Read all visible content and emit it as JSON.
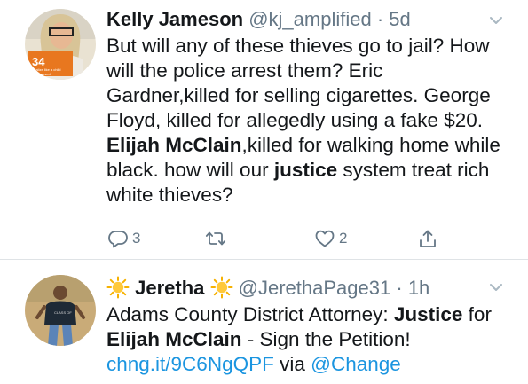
{
  "tweets": [
    {
      "name": "Kelly Jameson",
      "handle": "@kj_amplified",
      "separator": "·",
      "time": "5d",
      "body": [
        {
          "t": "But will any of these thieves go to jail? How will the police arrest them? Eric Gardner,killed for selling cigarettes. George Floyd, killed for allegedly using a fake $20. ",
          "b": false
        },
        {
          "t": "Elijah McClain",
          "b": true
        },
        {
          "t": ",killed for walking home while black. how will our ",
          "b": false
        },
        {
          "t": "justice",
          "b": true
        },
        {
          "t": " system treat rich white thieves?",
          "b": false
        }
      ],
      "avatar_text": {
        "number": "34",
        "line1": "ogalize like a child",
        "line2": "is proposed"
      },
      "actions": {
        "reply_count": "3",
        "retweet_count": "",
        "like_count": "2"
      }
    },
    {
      "name": "Jeretha",
      "handle": "@JerethaPage31",
      "separator": "·",
      "time": "1h",
      "body": [
        {
          "t": "Adams County District Attorney: ",
          "b": false
        },
        {
          "t": "Justice",
          "b": true
        },
        {
          "t": " for ",
          "b": false
        },
        {
          "t": "Elijah McClain",
          "b": true
        },
        {
          "t": " - Sign the Petition! ",
          "b": false
        },
        {
          "t": "chng.it/9C6NgQPF",
          "b": false,
          "link": true
        },
        {
          "t": " via ",
          "b": false
        },
        {
          "t": "@Change",
          "b": false,
          "link": true
        }
      ]
    }
  ],
  "icons": {
    "reply": "reply-icon",
    "retweet": "retweet-icon",
    "like": "heart-icon",
    "share": "share-icon",
    "caret": "chevron-down-icon",
    "sun": "sun-emoji-icon"
  },
  "colors": {
    "text": "#14171a",
    "secondary": "#657786",
    "link": "#1b95e0",
    "divider": "#dfe3e6"
  }
}
